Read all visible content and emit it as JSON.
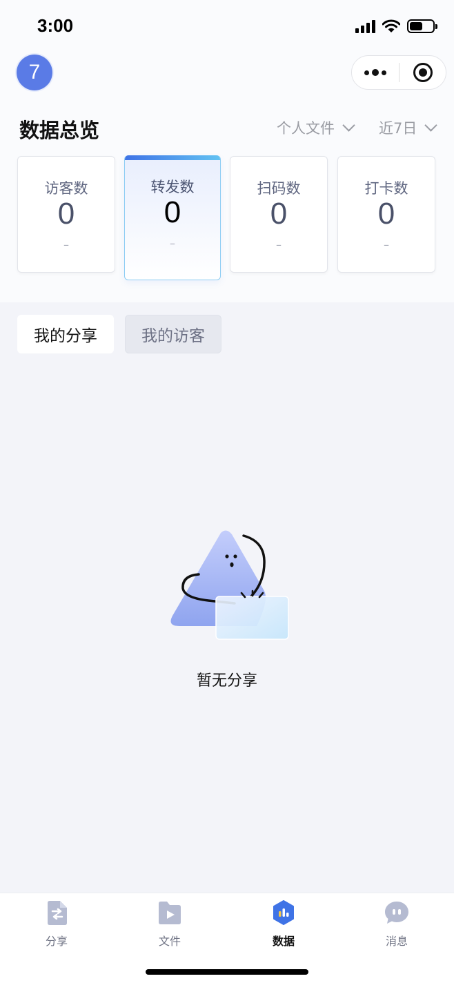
{
  "status_bar": {
    "time": "3:00"
  },
  "header": {
    "avatar_text": "7"
  },
  "overview": {
    "title": "数据总览",
    "filter_scope": "个人文件",
    "filter_range": "近7日"
  },
  "stats": [
    {
      "label": "访客数",
      "value": "0",
      "trend": "–"
    },
    {
      "label": "转发数",
      "value": "0",
      "trend": "–"
    },
    {
      "label": "扫码数",
      "value": "0",
      "trend": "–"
    },
    {
      "label": "打卡数",
      "value": "0",
      "trend": "–"
    }
  ],
  "tabs": [
    {
      "label": "我的分享"
    },
    {
      "label": "我的访客"
    }
  ],
  "empty_state": {
    "text": "暂无分享"
  },
  "bottom_nav": [
    {
      "label": "分享",
      "icon": "share-doc-icon"
    },
    {
      "label": "文件",
      "icon": "video-folder-icon"
    },
    {
      "label": "数据",
      "icon": "bar-chart-icon"
    },
    {
      "label": "消息",
      "icon": "chat-bubble-icon"
    }
  ],
  "colors": {
    "accent": "#3f73e6",
    "accent_light": "#62c2f2",
    "avatar": "#5a7be6",
    "page_bg": "#f3f4f9",
    "nav_icon": "#b5bbd1"
  }
}
